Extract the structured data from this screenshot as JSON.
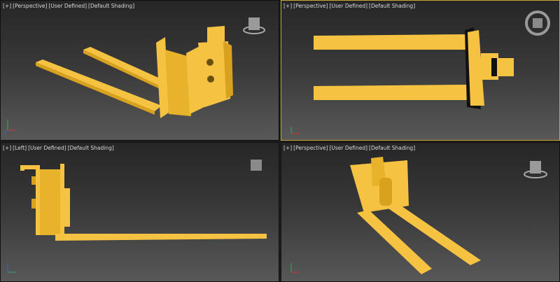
{
  "viewports": [
    {
      "menu": "[+]",
      "view": "[Perspective]",
      "mode": "[User Defined]",
      "shading": "[Default Shading]",
      "active": false
    },
    {
      "menu": "[+]",
      "view": "[Perspective]",
      "mode": "[User Defined]",
      "shading": "[Default Shading]",
      "active": true
    },
    {
      "menu": "[+]",
      "view": "[Left]",
      "mode": "[User Defined]",
      "shading": "[Default Shading]",
      "active": false
    },
    {
      "menu": "[+]",
      "view": "[Perspective]",
      "mode": "[User Defined]",
      "shading": "[Default Shading]",
      "active": false
    }
  ],
  "colors": {
    "model": "#f5c242",
    "model_shade": "#d9a21e",
    "active_border": "#c8a832"
  },
  "icons": [
    "viewcube-icon",
    "steering-wheel-compass-icon",
    "axis-tripod-icon"
  ]
}
